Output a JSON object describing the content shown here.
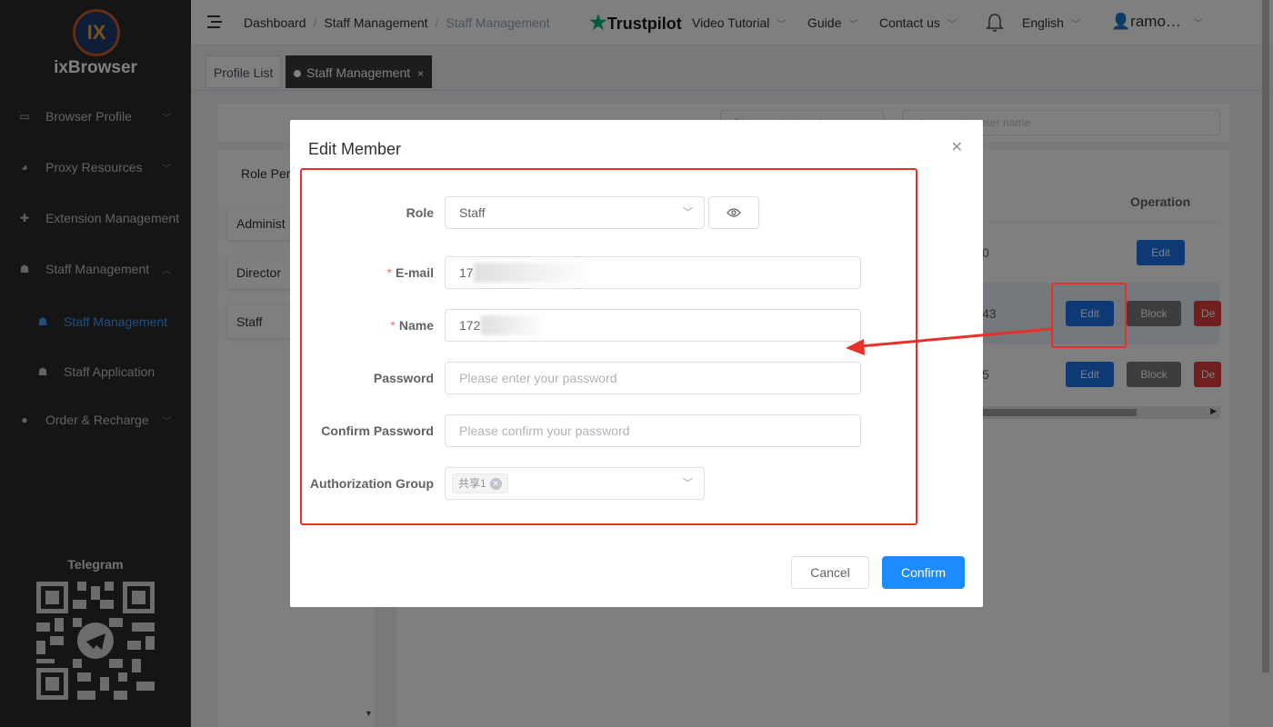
{
  "app": {
    "brand": "ixBrowser",
    "logo_text": "IX"
  },
  "sidebar": {
    "items": [
      {
        "label": "Browser Profile",
        "icon": "browser-icon"
      },
      {
        "label": "Proxy Resources",
        "icon": "globe-icon"
      },
      {
        "label": "Extension Management",
        "icon": "puzzle-icon"
      },
      {
        "label": "Staff Management",
        "icon": "staff-icon"
      },
      {
        "label": "Staff Management",
        "icon": "staff-icon",
        "active": true
      },
      {
        "label": "Staff Application",
        "icon": "user-icon"
      },
      {
        "label": "Order & Recharge",
        "icon": "coin-icon"
      }
    ],
    "telegram_label": "Telegram"
  },
  "header": {
    "breadcrumb": [
      "Dashboard",
      "Staff Management",
      "Staff Management"
    ],
    "trustpilot": "Trustpilot",
    "video_tutorial": "Video Tutorial",
    "guide": "Guide",
    "contact_us": "Contact us",
    "language": "English",
    "username": "ramo…"
  },
  "tabs": [
    {
      "label": "Profile List"
    },
    {
      "label": "Staff Management",
      "active": true
    }
  ],
  "background": {
    "role_select_placeholder": "Please select a role",
    "search_placeholder": "please enter user name",
    "role_panel_title": "Role Per",
    "roles": [
      "Administ",
      "Director",
      "Staff"
    ],
    "operation_header": "Operation",
    "row_partial_values": [
      "0",
      "43",
      "5"
    ],
    "edit_label": "Edit",
    "block_label": "Block",
    "delete_label": "De"
  },
  "dialog": {
    "title": "Edit Member",
    "role_label": "Role",
    "role_value": "Staff",
    "email_label": "E-mail",
    "email_value": "17",
    "name_label": "Name",
    "name_value": "172",
    "password_label": "Password",
    "password_placeholder": "Please enter your password",
    "confirm_password_label": "Confirm Password",
    "confirm_password_placeholder": "Please confirm your password",
    "auth_group_label": "Authorization Group",
    "auth_group_tag": "共享1",
    "cancel_label": "Cancel",
    "confirm_label": "Confirm"
  },
  "colors": {
    "sidebar_bg": "#2b2b2b",
    "accent": "#409eff",
    "confirm_button": "#1a8cff",
    "annotation_red": "#e8302a"
  }
}
